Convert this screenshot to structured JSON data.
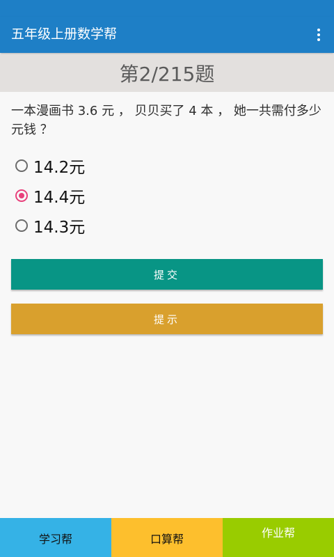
{
  "app_bar": {
    "title": "五年级上册数学帮",
    "overflow_icon": "more-vert-icon"
  },
  "question": {
    "number_label": "第2/215题",
    "text": "一本漫画书 3.6 元 ， 贝贝买了 4 本 ， 她一共需付多少元钱 ？"
  },
  "options": [
    {
      "label": "14.2元",
      "selected": false
    },
    {
      "label": "14.4元",
      "selected": true
    },
    {
      "label": "14.3元",
      "selected": false
    }
  ],
  "buttons": {
    "submit_label": "提交",
    "hint_label": "提示"
  },
  "bottom_nav": {
    "items": [
      {
        "label": "学习帮"
      },
      {
        "label": "口算帮"
      },
      {
        "label": "作业帮"
      }
    ]
  },
  "colors": {
    "app_bar": "#1e7fc6",
    "question_header_bg": "#e3e0de",
    "radio_selected": "#e8407b",
    "submit_button": "#089585",
    "hint_button": "#d9a02d",
    "nav_study": "#35b2e6",
    "nav_mental": "#fdbf2d",
    "nav_homework": "#99cc00"
  }
}
